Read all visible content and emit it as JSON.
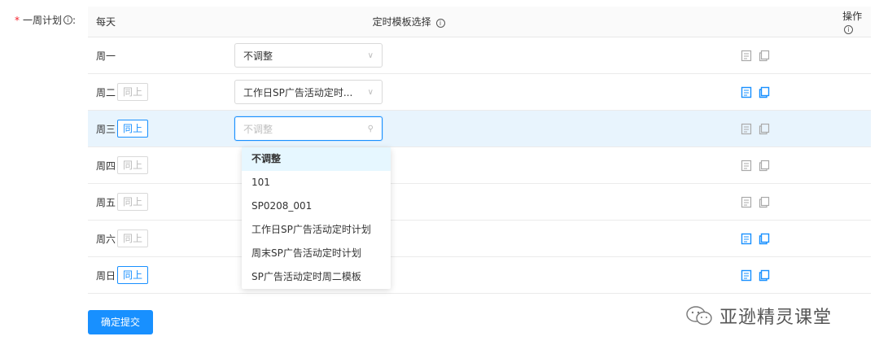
{
  "form": {
    "label": "一周计划",
    "required_mark": "*",
    "colon": ":"
  },
  "table": {
    "headers": {
      "day": "每天",
      "template": "定时模板选择",
      "ops": "操作"
    },
    "rows": [
      {
        "day": "周一",
        "same": "",
        "value": "不调整"
      },
      {
        "day": "周二",
        "same": "同上",
        "value": "工作日SP广告活动定时..."
      },
      {
        "day": "周三",
        "same": "同上",
        "value": "不调整"
      },
      {
        "day": "周四",
        "same": "同上",
        "value": ""
      },
      {
        "day": "周五",
        "same": "同上",
        "value": ""
      },
      {
        "day": "周六",
        "same": "同上",
        "value": ""
      },
      {
        "day": "周日",
        "same": "同上",
        "value": ""
      }
    ]
  },
  "dropdown": {
    "options": [
      "不调整",
      "101",
      "SP0208_001",
      "工作日SP广告活动定时计划",
      "周末SP广告活动定时计划",
      "SP广告活动定时周二模板"
    ]
  },
  "submit_label": "确定提交",
  "watermark": "亚逊精灵课堂",
  "colors": {
    "primary": "#1890ff",
    "active_row": "#e8f4fd"
  }
}
